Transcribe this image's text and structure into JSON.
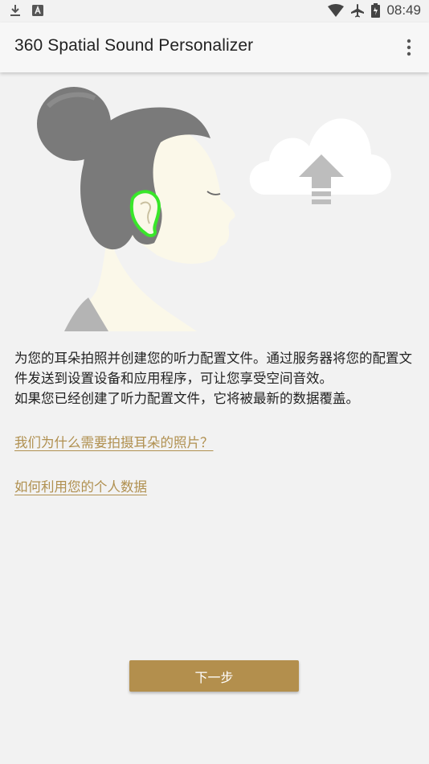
{
  "status_bar": {
    "time": "08:49",
    "left_icons": [
      "download-icon",
      "keyboard-icon"
    ],
    "right_icons": [
      "wifi-icon",
      "airplane-icon",
      "battery-icon"
    ]
  },
  "app_bar": {
    "title": "360 Spatial Sound Personalizer",
    "overflow_icon": "more-vert-icon"
  },
  "hero": {
    "illustration": "head-profile-with-highlighted-ear",
    "cloud_icon": "cloud-upload-icon",
    "ear_highlight_color": "#39e62a"
  },
  "description": {
    "line1": "为您的耳朵拍照并创建您的听力配置文件。通过服务器将您的配置文件发送到设置设备和应用程序，可让您享受空间音效。",
    "line2": "如果您已经创建了听力配置文件，它将被最新的数据覆盖。"
  },
  "links": {
    "why_photo": "我们为什么需要拍摄耳朵的照片？",
    "personal_data": "如何利用您的个人数据"
  },
  "next_button": {
    "label": "下一步"
  },
  "colors": {
    "accent": "#b38f4d",
    "link": "#b09050",
    "background": "#f2f2f2"
  }
}
